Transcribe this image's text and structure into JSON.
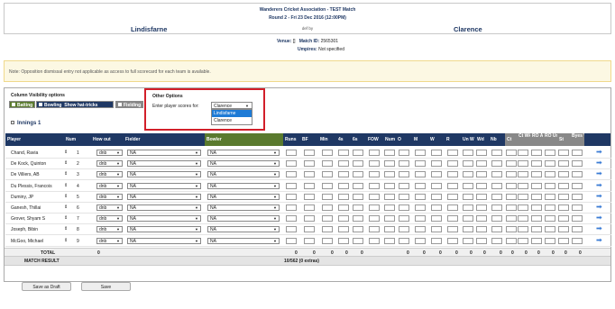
{
  "match": {
    "title": "Wanderers Cricket Association - TEST Match",
    "round": "Round 2 - Fri 23 Dec 2016 (12:00PM)",
    "home": "Lindisfarne",
    "def": "def by",
    "away": "Clarence",
    "venue_label": "Venue:",
    "venue": "[]",
    "match_id_label": "Match ID:",
    "match_id": "2565301",
    "umpires_label": "Umpires:",
    "umpires": "Not specified"
  },
  "note": "Note: Opposition dismissal entry not applicable as access to full scorecard for each team is available.",
  "options": {
    "col_vis_title": "Column Visibility options",
    "batting": "Batting",
    "bowling": "Bowling",
    "hattricks": "Show hat-tricks",
    "fielding": "Fielding",
    "other_title": "Other Options",
    "enter_label": "Enter player scores for:",
    "selected": "Clarence",
    "choices": [
      "Lindisfarne",
      "Clarence"
    ]
  },
  "innings": "Innings 1",
  "headers": {
    "player": "Player",
    "num": "Num",
    "howout": "How out",
    "fielder": "Fielder",
    "bowler": "Bowler",
    "runs": "Runs",
    "bf": "BF",
    "min": "Min",
    "fours": "4s",
    "sixes": "6s",
    "fow": "FOW",
    "num2": "Num",
    "o": "O",
    "m": "M",
    "w": "W",
    "r": "R",
    "unw": "Un W",
    "wd": "Wd",
    "nb": "Nb",
    "ct": "Ct",
    "ctwk": "Ct Wk",
    "roas": "RO As",
    "rouna": "RO Unas",
    "st": "St",
    "byeswk": "Byes Wk"
  },
  "players": [
    {
      "name": "Chand, Ravia",
      "num": "1",
      "howout": "dnb",
      "fielder": "NA",
      "bowler": "NA"
    },
    {
      "name": "De Kock, Quinton",
      "num": "2",
      "howout": "dnb",
      "fielder": "NA",
      "bowler": "NA"
    },
    {
      "name": "De Villiers, AB",
      "num": "3",
      "howout": "dnb",
      "fielder": "NA",
      "bowler": "NA"
    },
    {
      "name": "Du Plessis, Francois",
      "num": "4",
      "howout": "dnb",
      "fielder": "NA",
      "bowler": "NA"
    },
    {
      "name": "Duminy, JP",
      "num": "5",
      "howout": "dnb",
      "fielder": "NA",
      "bowler": "NA"
    },
    {
      "name": "Ganesh, Thillai",
      "num": "6",
      "howout": "dnb",
      "fielder": "NA",
      "bowler": "NA"
    },
    {
      "name": "Grover, Shyam S",
      "num": "7",
      "howout": "dnb",
      "fielder": "NA",
      "bowler": "NA"
    },
    {
      "name": "Joseph, Bibin",
      "num": "8",
      "howout": "dnb",
      "fielder": "NA",
      "bowler": "NA"
    },
    {
      "name": "McGoo, Michael",
      "num": "9",
      "howout": "dnb",
      "fielder": "NA",
      "bowler": "NA"
    }
  ],
  "totals": {
    "label": "TOTAL",
    "num": "0",
    "runs": "0",
    "bf": "0",
    "min": "0",
    "fours": "0",
    "sixes": "0",
    "o": "0",
    "m": "0",
    "w": "0",
    "r": "0",
    "unw": "0",
    "wd": "0",
    "nb": "0",
    "ct": "0",
    "ctwk": "0",
    "roas": "0",
    "rouna": "0",
    "st": "0",
    "byeswk": "0"
  },
  "match_result": {
    "label": "MATCH RESULT",
    "value": "10/562 (0 extras)"
  },
  "buttons": {
    "draft": "Save as Draft",
    "save": "Save"
  },
  "colors": {
    "navy": "#1f3864",
    "green": "#5a7a2e",
    "gray": "#888888",
    "highlight": "#d21f2a",
    "arrow": "#3a7bd5",
    "note_bg": "#fcf8e3"
  }
}
